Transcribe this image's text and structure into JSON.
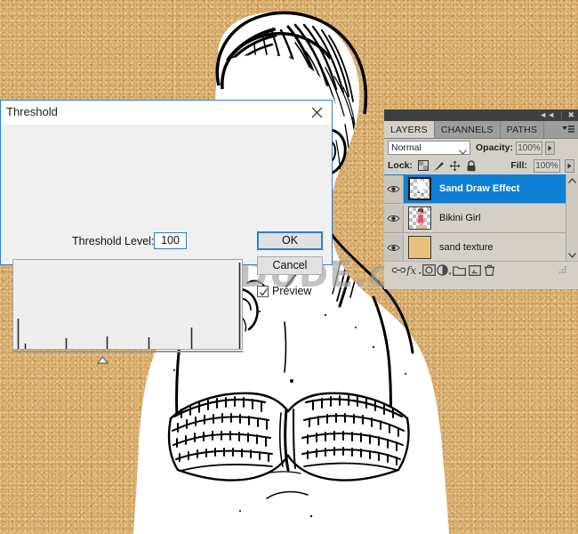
{
  "app": {
    "background_color": "#dcb06d",
    "watermark": "www.PSD-DUDE.com"
  },
  "dialog": {
    "title": "Threshold",
    "close_icon": "close-icon",
    "level_label": "Threshold Level:",
    "level_value": "100",
    "ok_label": "OK",
    "cancel_label": "Cancel",
    "preview_label": "Preview",
    "preview_checked": true,
    "accent_color": "#2a7fd4",
    "histogram": {
      "marker_position_pct": 39,
      "spikes": [
        {
          "x_pct": 2,
          "height_pct": 34
        },
        {
          "x_pct": 5,
          "height_pct": 6
        },
        {
          "x_pct": 23,
          "height_pct": 12
        },
        {
          "x_pct": 41,
          "height_pct": 14
        },
        {
          "x_pct": 59,
          "height_pct": 13
        },
        {
          "x_pct": 78,
          "height_pct": 24
        },
        {
          "x_pct": 99,
          "height_pct": 97
        }
      ]
    }
  },
  "panel": {
    "dock": {
      "collapse_icon": "collapse-double-arrow-icon",
      "close_icon": "panel-close-icon"
    },
    "tabs": [
      {
        "label": "LAYERS",
        "active": true
      },
      {
        "label": "CHANNELS",
        "active": false
      },
      {
        "label": "PATHS",
        "active": false
      }
    ],
    "menu_icon": "panel-menu-icon",
    "blend_mode": "Normal",
    "opacity_label": "Opacity:",
    "opacity_value": "100%",
    "lock_label": "Lock:",
    "lock_icons": [
      "lock-transparency-icon",
      "lock-image-icon",
      "lock-position-icon",
      "lock-all-icon"
    ],
    "fill_label": "Fill:",
    "fill_value": "100%",
    "layers": [
      {
        "name": "Sand Draw Effect",
        "visible": true,
        "selected": true,
        "thumb": "transparent-sketch"
      },
      {
        "name": "Bikini Girl",
        "visible": true,
        "selected": false,
        "thumb": "photo-girl"
      },
      {
        "name": "sand texture",
        "visible": true,
        "selected": false,
        "thumb": "sand-swatch"
      }
    ],
    "selection_color": "#0f7fd4",
    "footer_icons": [
      "link-layers-icon",
      "layer-style-fx-icon",
      "layer-mask-icon",
      "adjustment-layer-icon",
      "new-group-icon",
      "new-layer-icon",
      "delete-layer-icon"
    ],
    "scrollbar": {
      "up_icon": "scroll-up-icon",
      "down_icon": "scroll-down-icon"
    }
  },
  "canvas": {
    "artwork_name": "sand-draw-threshold-portrait",
    "line_color": "#000000",
    "fill_color": "#ffffff"
  }
}
